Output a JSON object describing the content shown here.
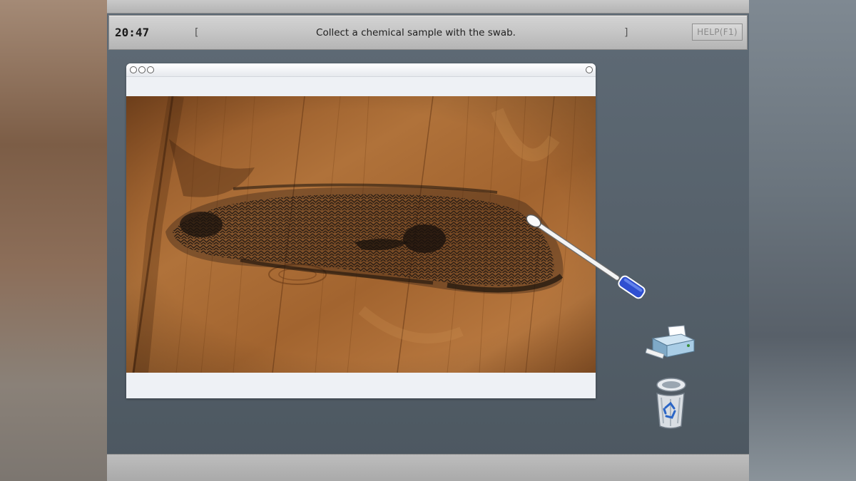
{
  "hud": {
    "clock": "20:47",
    "bracket_open": "[",
    "message": "Collect a chemical sample with the swab.",
    "bracket_close": "]",
    "help_label": "HELP(F1)"
  },
  "evidence_window": {
    "title_buttons": [
      "close-icon",
      "minimize-icon",
      "zoom-icon"
    ],
    "right_button": "maximize-icon",
    "image_subject": "shoeprint-on-wooden-floor"
  },
  "tools": [
    {
      "name": "swab",
      "icon": "cotton-swab-icon",
      "color": "#2f4fd0"
    },
    {
      "name": "printer",
      "icon": "printer-icon"
    },
    {
      "name": "trash",
      "icon": "recycle-bin-icon"
    }
  ],
  "colors": {
    "toolbar": "#c6c6c6",
    "desktop": "#56616b",
    "wood": "#a0642e",
    "swab_handle": "#2f4fd0"
  }
}
